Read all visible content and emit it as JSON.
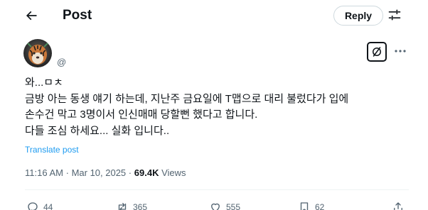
{
  "header": {
    "back_icon": "arrow-left-icon",
    "title": "Post",
    "reply_label": "Reply",
    "adjust_icon": "adjust-icon"
  },
  "author": {
    "handle": "@",
    "avatar_icon": "tiger-avatar"
  },
  "tweet": {
    "lines": [
      "와...ㅁㅊ",
      "금방 아는 동생 얘기 하는데, 지난주 금요일에 T맵으로 대리 불렀다가 입에",
      "손수건 막고 3명이서 인신매매 당할뻔 했다고 합니다.",
      "다들 조심 하세요... 실화 입니다.."
    ],
    "translate_label": "Translate post"
  },
  "meta": {
    "time": "11:16 AM",
    "separator": "·",
    "date": "Mar 10, 2025",
    "views_count": "69.4K",
    "views_label": "Views"
  },
  "actions": {
    "reply_count": "44",
    "repost_count": "365",
    "like_count": "555",
    "bookmark_count": "62"
  },
  "colors": {
    "link": "#1d9bf0",
    "muted": "#536471",
    "text": "#0f1419",
    "border": "#cfd9de"
  }
}
